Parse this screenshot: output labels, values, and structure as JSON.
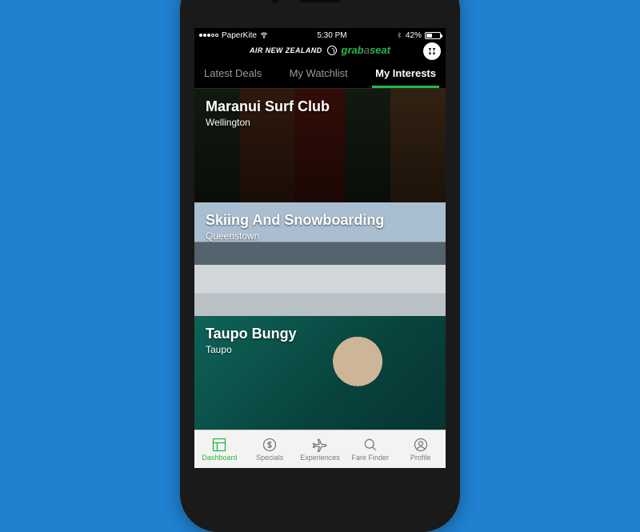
{
  "statusbar": {
    "carrier": "PaperKite",
    "time": "5:30 PM",
    "battery_pct": "42%"
  },
  "header": {
    "brand1": "AIR NEW ZEALAND",
    "brand2_grab": "grab",
    "brand2_a": "a",
    "brand2_seat": "seat"
  },
  "tabs": [
    {
      "label": "Latest Deals",
      "active": false
    },
    {
      "label": "My Watchlist",
      "active": false
    },
    {
      "label": "My Interests",
      "active": true
    }
  ],
  "cards": [
    {
      "title": "Maranui Surf Club",
      "subtitle": "Wellington"
    },
    {
      "title": "Skiing And Snowboarding",
      "subtitle": "Queenstown"
    },
    {
      "title": "Taupo Bungy",
      "subtitle": "Taupo"
    }
  ],
  "tabbar": [
    {
      "label": "Dashboard",
      "active": true
    },
    {
      "label": "Specials",
      "active": false
    },
    {
      "label": "Experiences",
      "active": false
    },
    {
      "label": "Fare Finder",
      "active": false
    },
    {
      "label": "Profile",
      "active": false
    }
  ]
}
